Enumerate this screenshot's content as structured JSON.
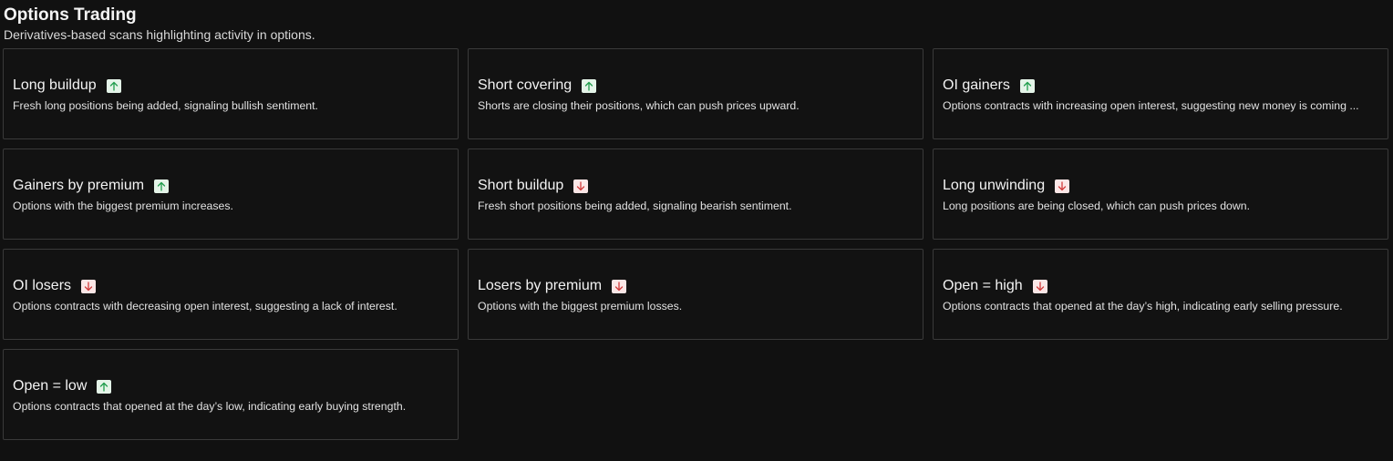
{
  "section": {
    "title": "Options Trading",
    "subtitle": "Derivatives-based scans highlighting activity in options."
  },
  "colors": {
    "up_arrow": "#1f9d4c",
    "up_badge_bg": "#e4f4e8",
    "down_arrow": "#d23b3b",
    "down_badge_bg": "#fbe6e6"
  },
  "cards": [
    {
      "title": "Long buildup",
      "description": "Fresh long positions being added, signaling bullish sentiment.",
      "trend": "up",
      "icon": "arrow-up-icon"
    },
    {
      "title": "Short covering",
      "description": "Shorts are closing their positions, which can push prices upward.",
      "trend": "up",
      "icon": "arrow-up-icon"
    },
    {
      "title": "OI gainers",
      "description": "Options contracts with increasing open interest, suggesting new money is coming ...",
      "trend": "up",
      "icon": "arrow-up-icon"
    },
    {
      "title": "Gainers by premium",
      "description": "Options with the biggest premium increases.",
      "trend": "up",
      "icon": "arrow-up-icon"
    },
    {
      "title": "Short buildup",
      "description": "Fresh short positions being added, signaling bearish sentiment.",
      "trend": "down",
      "icon": "arrow-down-icon"
    },
    {
      "title": "Long unwinding",
      "description": "Long positions are being closed, which can push prices down.",
      "trend": "down",
      "icon": "arrow-down-icon"
    },
    {
      "title": "OI losers",
      "description": "Options contracts with decreasing open interest, suggesting a lack of interest.",
      "trend": "down",
      "icon": "arrow-down-icon"
    },
    {
      "title": "Losers by premium",
      "description": "Options with the biggest premium losses.",
      "trend": "down",
      "icon": "arrow-down-icon"
    },
    {
      "title": "Open = high",
      "description": "Options contracts that opened at the day’s high, indicating early selling pressure.",
      "trend": "down",
      "icon": "arrow-down-icon"
    },
    {
      "title": "Open = low",
      "description": "Options contracts that opened at the day’s low, indicating early buying strength.",
      "trend": "up",
      "icon": "arrow-up-icon"
    }
  ]
}
